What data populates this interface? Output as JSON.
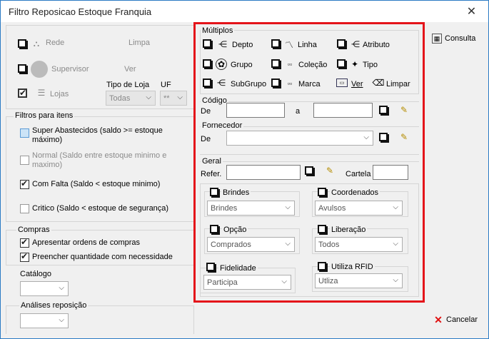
{
  "window": {
    "title": "Filtro Reposicao Estoque Franquia",
    "close": "✕"
  },
  "left": {
    "rede": "Rede",
    "limpa": "Limpa",
    "supervisor": "Supervisor",
    "ver": "Ver",
    "lojas": "Lojas",
    "tipo_loja_label": "Tipo de Loja",
    "tipo_loja_value": "Todas",
    "uf_label": "UF",
    "uf_value": "**",
    "filtros_title": "Filtros para itens",
    "super": "Super Abastecidos  (saldo >= estoque máximo)",
    "normal": "Normal (Saldo entre estoque minimo e maximo)",
    "falta": "Com Falta (Saldo < estoque minimo)",
    "critico": "Critico (Saldo < estoque de segurança)",
    "compras_title": "Compras",
    "apresentar": "Apresentar ordens de compras",
    "preencher": "Preencher quantidade com necessidade",
    "catalogo": "Catálogo",
    "analises": "Análises reposição"
  },
  "multiplos": {
    "title": "Múltiplos",
    "depto": "Depto",
    "linha": "Linha",
    "atributo": "Atributo",
    "grupo": "Grupo",
    "colecao": "Coleção",
    "tipo": "Tipo",
    "subgrupo": "SubGrupo",
    "marca": "Marca",
    "ver": "Ver",
    "limpar": "Limpar"
  },
  "codigo": {
    "title": "Código",
    "de": "De",
    "a": "a"
  },
  "fornecedor": {
    "title": "Fornecedor",
    "de": "De"
  },
  "geral": {
    "title": "Geral",
    "refer": "Refer.",
    "cartela": "Cartela"
  },
  "opts": {
    "brindes": {
      "label": "Brindes",
      "value": "Brindes"
    },
    "coordenados": {
      "label": "Coordenados",
      "value": "Avulsos"
    },
    "opcao": {
      "label": "Opção",
      "value": "Comprados"
    },
    "liberacao": {
      "label": "Liberação",
      "value": "Todos"
    },
    "fidelidade": {
      "label": "Fidelidade",
      "value": "Participa"
    },
    "rfid": {
      "label": "Utiliza RFID",
      "value": "Utliza"
    }
  },
  "buttons": {
    "consulta": "Consulta",
    "cancelar": "Cancelar"
  }
}
